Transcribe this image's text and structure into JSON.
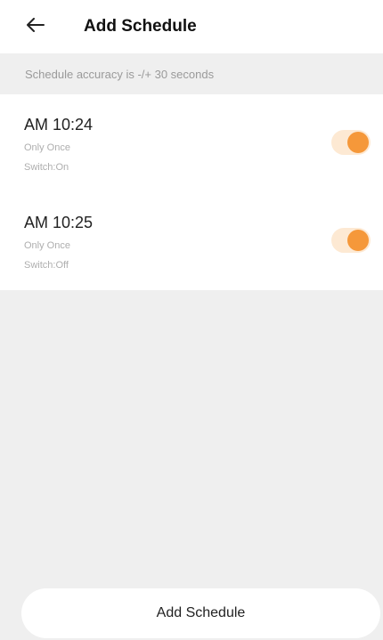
{
  "header": {
    "back_icon": "arrow-left-icon",
    "title": "Add Schedule"
  },
  "notice": "Schedule accuracy is -/+ 30 seconds",
  "schedules": [
    {
      "time": "AM 10:24",
      "repeat": "Only Once",
      "action": "Switch:On",
      "enabled": true
    },
    {
      "time": "AM 10:25",
      "repeat": "Only Once",
      "action": "Switch:Off",
      "enabled": true
    }
  ],
  "footer": {
    "add_button_label": "Add Schedule"
  },
  "colors": {
    "accent": "#f5983a",
    "toggle_track": "#fde9d3",
    "background": "#efefef"
  }
}
